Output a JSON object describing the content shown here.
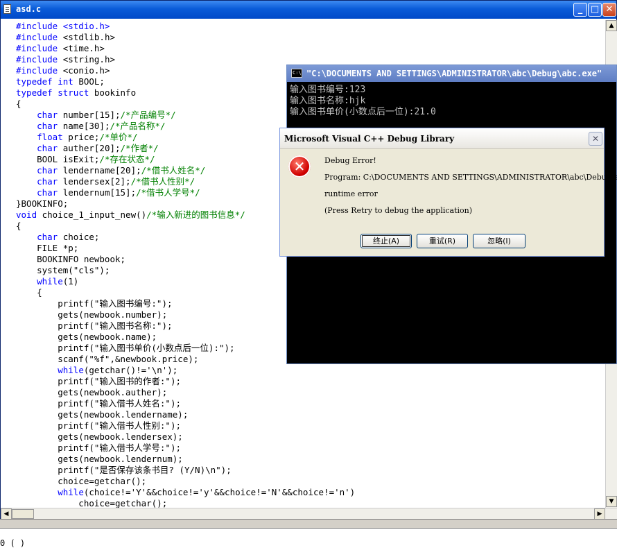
{
  "editor": {
    "title": "asd.c",
    "min_glyph": "_",
    "max_glyph": "□",
    "close_glyph": "✕"
  },
  "code_lines": [
    [
      [
        "#include <stdio.h>",
        "kw"
      ]
    ],
    [
      [
        "#include",
        "kw"
      ],
      [
        " <stdlib.h>",
        ""
      ]
    ],
    [
      [
        "#include",
        "kw"
      ],
      [
        " <time.h>",
        ""
      ]
    ],
    [
      [
        "#include",
        "kw"
      ],
      [
        " <string.h>",
        ""
      ]
    ],
    [
      [
        "#include",
        "kw"
      ],
      [
        " <conio.h>",
        ""
      ]
    ],
    [
      [
        "typedef",
        "kw"
      ],
      [
        " ",
        ""
      ],
      [
        "int",
        "kw"
      ],
      [
        " BOOL;",
        ""
      ]
    ],
    [
      [
        "typedef",
        "kw"
      ],
      [
        " ",
        ""
      ],
      [
        "struct",
        "kw"
      ],
      [
        " bookinfo",
        ""
      ]
    ],
    [
      [
        "{",
        ""
      ]
    ],
    [
      [
        "    ",
        ""
      ],
      [
        "char",
        "kw"
      ],
      [
        " number[15];",
        ""
      ],
      [
        "/*产品编号*/",
        "cm"
      ]
    ],
    [
      [
        "    ",
        ""
      ],
      [
        "char",
        "kw"
      ],
      [
        " name[30];",
        ""
      ],
      [
        "/*产品名称*/",
        "cm"
      ]
    ],
    [
      [
        "    ",
        ""
      ],
      [
        "float",
        "kw"
      ],
      [
        " price;",
        ""
      ],
      [
        "/*单价*/",
        "cm"
      ]
    ],
    [
      [
        "    ",
        ""
      ],
      [
        "char",
        "kw"
      ],
      [
        " auther[20];",
        ""
      ],
      [
        "/*作者*/",
        "cm"
      ]
    ],
    [
      [
        "    BOOL isExit;",
        ""
      ],
      [
        "/*存在状态*/",
        "cm"
      ]
    ],
    [
      [
        "    ",
        ""
      ],
      [
        "char",
        "kw"
      ],
      [
        " lendername[20];",
        ""
      ],
      [
        "/*借书人姓名*/",
        "cm"
      ]
    ],
    [
      [
        "    ",
        ""
      ],
      [
        "char",
        "kw"
      ],
      [
        " lendersex[2];",
        ""
      ],
      [
        "/*借书人性别*/",
        "cm"
      ]
    ],
    [
      [
        "    ",
        ""
      ],
      [
        "char",
        "kw"
      ],
      [
        " lendernum[15];",
        ""
      ],
      [
        "/*借书人学号*/",
        "cm"
      ]
    ],
    [
      [
        "}BOOKINFO;",
        ""
      ]
    ],
    [
      [
        "void",
        "kw"
      ],
      [
        " choice_1_input_new()",
        ""
      ],
      [
        "/*输入新进的图书信息*/",
        "cm"
      ]
    ],
    [
      [
        "{",
        ""
      ]
    ],
    [
      [
        "    ",
        ""
      ],
      [
        "char",
        "kw"
      ],
      [
        " choice;",
        ""
      ]
    ],
    [
      [
        "    FILE *p;",
        ""
      ]
    ],
    [
      [
        "    BOOKINFO newbook;",
        ""
      ]
    ],
    [
      [
        "    system(\"cls\");",
        ""
      ]
    ],
    [
      [
        "    ",
        ""
      ],
      [
        "while",
        "kw"
      ],
      [
        "(1)",
        ""
      ]
    ],
    [
      [
        "    {",
        ""
      ]
    ],
    [
      [
        "        printf(\"输入图书编号:\");",
        ""
      ]
    ],
    [
      [
        "        gets(newbook.number);",
        ""
      ]
    ],
    [
      [
        "        printf(\"输入图书名称:\");",
        ""
      ]
    ],
    [
      [
        "        gets(newbook.name);",
        ""
      ]
    ],
    [
      [
        "        printf(\"输入图书单价(小数点后一位):\");",
        ""
      ]
    ],
    [
      [
        "        scanf(\"%f\",&newbook.price);",
        ""
      ]
    ],
    [
      [
        "        ",
        ""
      ],
      [
        "while",
        "kw"
      ],
      [
        "(getchar()!='\\n');",
        ""
      ]
    ],
    [
      [
        "        printf(\"输入图书的作者:\");",
        ""
      ]
    ],
    [
      [
        "        gets(newbook.auther);",
        ""
      ]
    ],
    [
      [
        "        printf(\"输入借书人姓名:\");",
        ""
      ]
    ],
    [
      [
        "        gets(newbook.lendername);",
        ""
      ]
    ],
    [
      [
        "        printf(\"输入借书人性别:\");",
        ""
      ]
    ],
    [
      [
        "        gets(newbook.lendersex);",
        ""
      ]
    ],
    [
      [
        "        printf(\"输入借书人学号:\");",
        ""
      ]
    ],
    [
      [
        "        gets(newbook.lendernum);",
        ""
      ]
    ],
    [
      [
        "        printf(\"是否保存该条书目? (Y/N)\\n\");",
        ""
      ]
    ],
    [
      [
        "        choice=getchar();",
        ""
      ]
    ],
    [
      [
        "        ",
        ""
      ],
      [
        "while",
        "kw"
      ],
      [
        "(choice!='Y'&&choice!='y'&&choice!='N'&&choice!='n')",
        ""
      ]
    ],
    [
      [
        "            choice=getchar();",
        ""
      ]
    ]
  ],
  "console": {
    "icon_text": "C:\\",
    "title": "\"C:\\DOCUMENTS AND SETTINGS\\ADMINISTRATOR\\abc\\Debug\\abc.exe\"",
    "lines": [
      "输入图书编号:123",
      "输入图书名称:hjk",
      "输入图书单价(小数点后一位):21.0"
    ]
  },
  "dialog": {
    "title": "Microsoft Visual C++ Debug Library",
    "close_glyph": "✕",
    "icon_glyph": "✕",
    "msg_error": "Debug Error!",
    "msg_program": "Program: C:\\DOCUMENTS AND SETTINGS\\ADMINISTRATOR\\abc\\Debug\\abc.exe",
    "msg_runtime": "runtime error",
    "msg_press": "(Press Retry to debug the application)",
    "btn_abort": "终止(A)",
    "btn_retry": "重试(R)",
    "btn_ignore": "忽略(I)"
  },
  "scroll": {
    "up": "▲",
    "down": "▼",
    "left": "◀",
    "right": "▶"
  },
  "bottom_text": "0         (    )"
}
